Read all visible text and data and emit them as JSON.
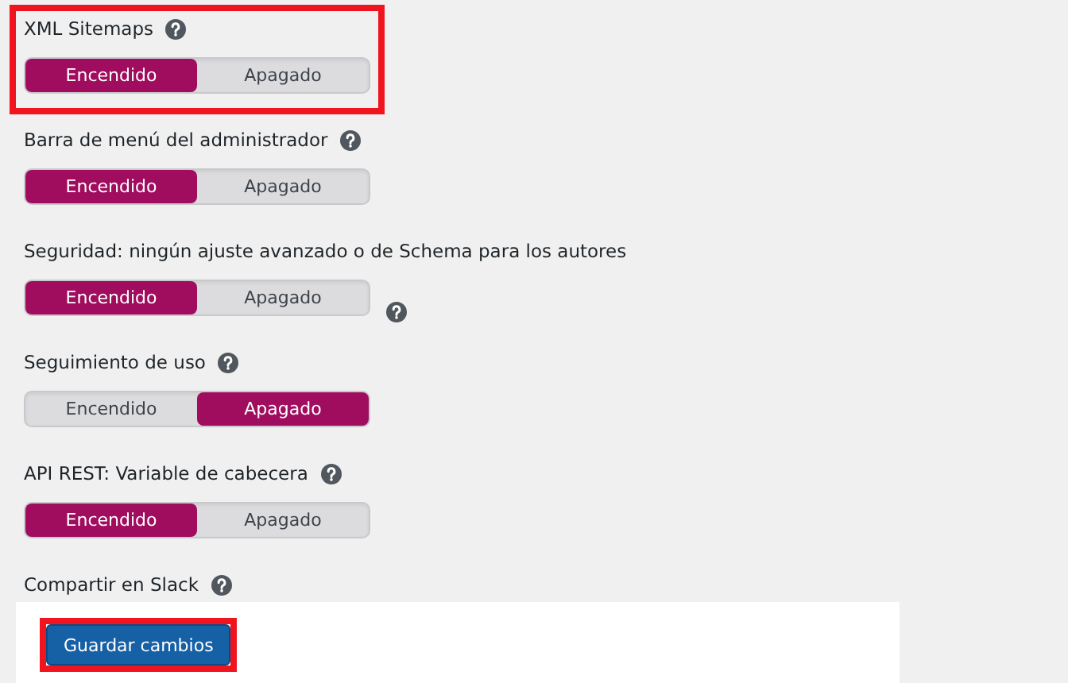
{
  "settings": [
    {
      "label": "XML Sitemaps",
      "kind": "inline",
      "highlighted": true,
      "options": [
        {
          "label": "Encendido",
          "selected": true
        },
        {
          "label": "Apagado",
          "selected": false
        }
      ]
    },
    {
      "label": "Barra de menú del administrador",
      "kind": "inline",
      "highlighted": false,
      "options": [
        {
          "label": "Encendido",
          "selected": true
        },
        {
          "label": "Apagado",
          "selected": false
        }
      ]
    },
    {
      "label": "Seguridad: ningún ajuste avanzado o de Schema para los autores",
      "kind": "trailing",
      "highlighted": false,
      "options": [
        {
          "label": "Encendido",
          "selected": true
        },
        {
          "label": "Apagado",
          "selected": false
        }
      ]
    },
    {
      "label": "Seguimiento de uso",
      "kind": "inline",
      "highlighted": false,
      "options": [
        {
          "label": "Encendido",
          "selected": false
        },
        {
          "label": "Apagado",
          "selected": true
        }
      ]
    },
    {
      "label": "API REST: Variable de cabecera",
      "kind": "inline",
      "highlighted": false,
      "options": [
        {
          "label": "Encendido",
          "selected": true
        },
        {
          "label": "Apagado",
          "selected": false
        }
      ]
    },
    {
      "label": "Compartir en Slack",
      "kind": "inline",
      "highlighted": false
    }
  ],
  "save_button": {
    "label": "Guardar cambios",
    "highlighted": true
  }
}
